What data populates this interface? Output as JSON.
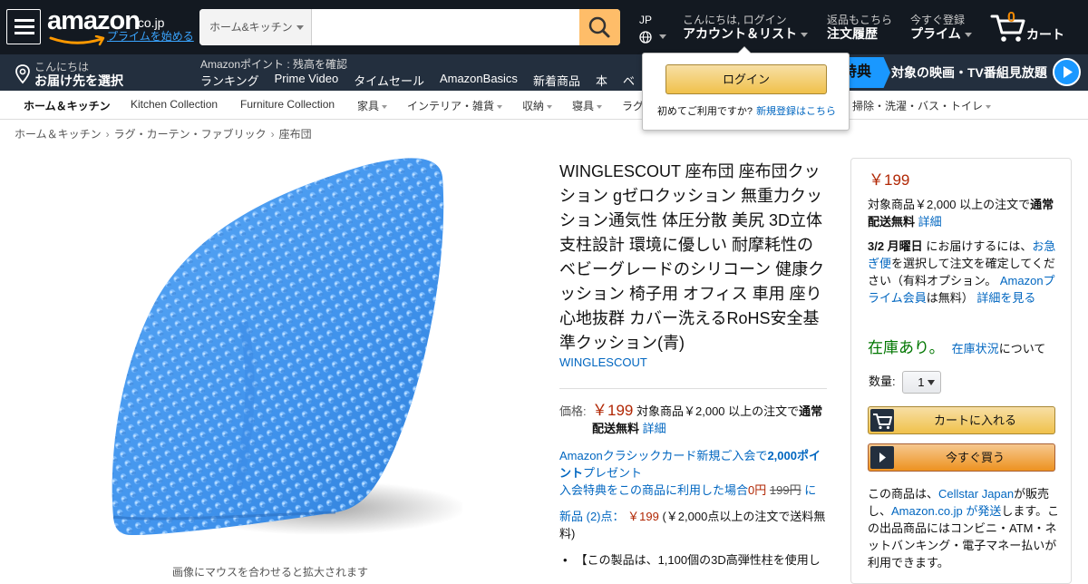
{
  "header": {
    "logo": {
      "word": "amazon",
      "tld": ".co.jp",
      "prime_link": "プライムを始める"
    },
    "search": {
      "category": "ホーム&キッチン",
      "query": ""
    },
    "locale": {
      "lang": "JP"
    },
    "account": {
      "line1": "こんにちは, ログイン",
      "line2": "アカウント＆リスト"
    },
    "orders": {
      "line1": "返品もこちら",
      "line2": "注文履歴"
    },
    "prime": {
      "line1": "今すぐ登録",
      "line2": "プライム"
    },
    "cart": {
      "count": "0",
      "label": "カート"
    }
  },
  "subnav": {
    "deliver_line1": "こんにちは",
    "deliver_line2": "お届け先を選択",
    "points": "Amazonポイント : 残高を確認",
    "links": [
      "ランキング",
      "Prime Video",
      "タイムセール",
      "AmazonBasics",
      "新着商品",
      "本",
      "ベ"
    ],
    "promo_badge": "特典",
    "promo_text": "対象の映画・TV番組見放題"
  },
  "category_bar": {
    "items": [
      {
        "label": "ホーム＆キッチン",
        "dropdown": false
      },
      {
        "label": "Kitchen Collection",
        "dropdown": false
      },
      {
        "label": "Furniture Collection",
        "dropdown": false
      },
      {
        "label": "家具",
        "dropdown": true
      },
      {
        "label": "インテリア・雑貨",
        "dropdown": true
      },
      {
        "label": "収納",
        "dropdown": true
      },
      {
        "label": "寝具",
        "dropdown": true
      },
      {
        "label": "ラグ",
        "dropdown": false
      },
      {
        "label": "掃除・洗濯・バス・トイレ",
        "dropdown": true
      }
    ]
  },
  "login_popover": {
    "button": "ログイン",
    "first_time": "初めてご利用ですか?",
    "register_link": "新規登録はこちら"
  },
  "breadcrumb": [
    "ホーム＆キッチン",
    "ラグ・カーテン・ファブリック",
    "座布団"
  ],
  "product": {
    "title": "WINGLESCOUT 座布団 座布団クッション gゼロクッション 無重力クッション通気性 体圧分散 美尻 3D立体支柱設計 環境に優しい 耐摩耗性のベビーグレードのシリコーン 健康クッション 椅子用 オフィス 車用 座り心地抜群 カバー洗えるRoHS安全基準クッション(青)",
    "brand": "WINGLESCOUT",
    "image_hint": "画像にマウスを合わせると拡大されます",
    "price_label": "価格:",
    "price": "￥199",
    "shipping_prefix": "対象商品￥2,000 以上の注文で",
    "shipping_bold": "通常配送無料",
    "details_link": "詳細",
    "card_promo_line1a": "Amazonクラシックカード新規ご入会で",
    "card_promo_bold": "2,000ポイント",
    "card_promo_line1b": "プレゼント",
    "card_promo_line2a": "入会特典をこの商品に利用した場合",
    "card_promo_zero": "0円",
    "card_promo_strike": "199円",
    "card_promo_tail": "に",
    "new_label": "新品 (2)点：",
    "new_price": "￥199",
    "new_tail": "(￥2,000点以上の注文で送料無料)",
    "bullet_1": "【この製品は、1,100個の3D高弾性柱を使用し"
  },
  "buybox": {
    "price": "￥199",
    "ship_prefix": "対象商品￥2,000 以上の注文で",
    "ship_bold": "通常配送無料",
    "ship_link": "詳細",
    "delivery_date": "3/2 月曜日",
    "delivery_mid": "にお届けするには、",
    "delivery_link": "お急ぎ便",
    "delivery_tail": "を選択して注文を確定してください（有料オプション。",
    "prime_link": "Amazonプライム会員",
    "prime_mid": "は無料）",
    "more_link": "詳細を見る",
    "stock": "在庫あり。",
    "stock_link": "在庫状況",
    "stock_tail": "について",
    "qty_label": "数量:",
    "qty_value": "1",
    "add_to_cart": "カートに入れる",
    "buy_now": "今すぐ買う",
    "seller_a": "この商品は、",
    "seller_link": "Cellstar Japan",
    "seller_b": "が販売し、",
    "ship_by_link": "Amazon.co.jp が発送",
    "seller_c": "します。この出品商品にはコンビニ・ATM・ネットバンキング・電子マネー払いが利用できます。"
  },
  "colors": {
    "nav_dark": "#131921",
    "nav_sub": "#232f3e",
    "accent_orange": "#febd69",
    "price_red": "#b12704",
    "link_blue": "#0066c0",
    "stock_green": "#007600",
    "cushion_blue": "#4a9cf0"
  }
}
